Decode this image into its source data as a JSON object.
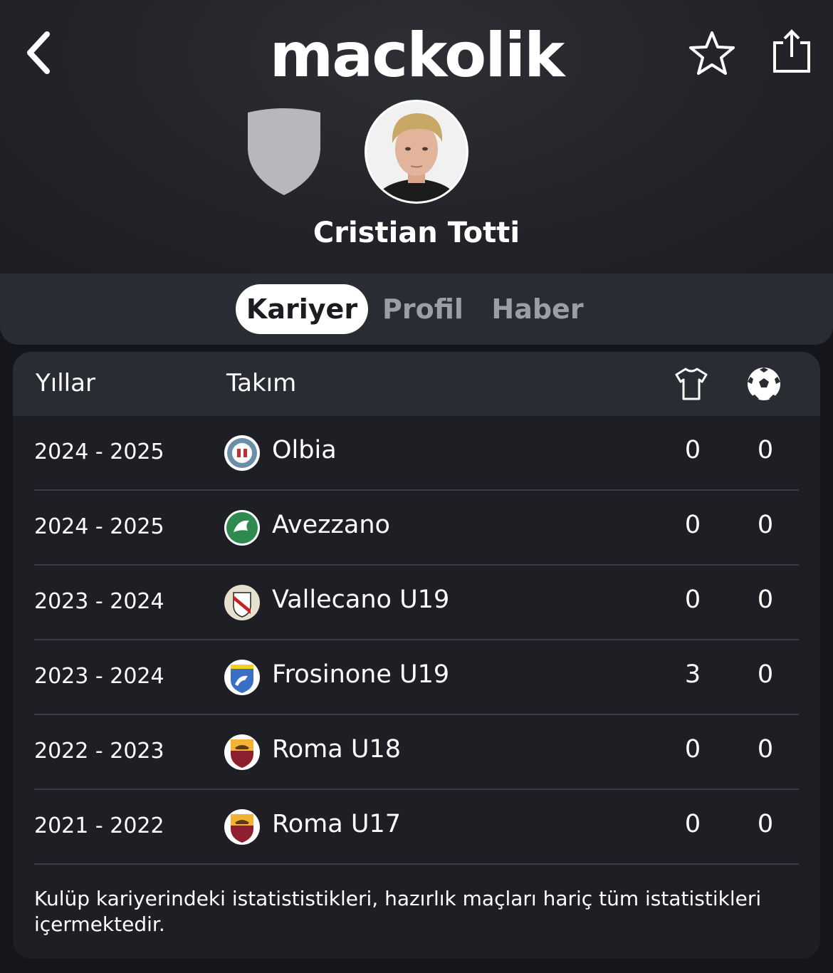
{
  "app": {
    "brand": "mackolik"
  },
  "player": {
    "name": "Cristian Totti"
  },
  "tabs": [
    {
      "label": "Kariyer",
      "active": true
    },
    {
      "label": "Profil",
      "active": false
    },
    {
      "label": "Haber",
      "active": false
    }
  ],
  "table": {
    "headers": {
      "years": "Yıllar",
      "team": "Takım",
      "apps_icon": "shirt-icon",
      "goals_icon": "ball-icon"
    },
    "rows": [
      {
        "years": "2024 - 2025",
        "team": "Olbia",
        "apps": "0",
        "goals": "0",
        "logo": "olbia-crest"
      },
      {
        "years": "2024 - 2025",
        "team": "Avezzano",
        "apps": "0",
        "goals": "0",
        "logo": "avezzano-crest"
      },
      {
        "years": "2023 - 2024",
        "team": "Vallecano U19",
        "apps": "0",
        "goals": "0",
        "logo": "vallecano-crest"
      },
      {
        "years": "2023 - 2024",
        "team": "Frosinone U19",
        "apps": "3",
        "goals": "0",
        "logo": "frosinone-crest"
      },
      {
        "years": "2022 - 2023",
        "team": "Roma U18",
        "apps": "0",
        "goals": "0",
        "logo": "roma-crest"
      },
      {
        "years": "2021 - 2022",
        "team": "Roma U17",
        "apps": "0",
        "goals": "0",
        "logo": "roma-crest"
      }
    ],
    "footnote": "Kulüp kariyerindeki istatististikleri, hazırlık maçları hariç tüm istatistikleri içermektedir."
  },
  "colors": {
    "background": "#15161b",
    "card": "#1e1f25",
    "header_row": "#2a2c33",
    "active_tab_bg": "#ffffff"
  }
}
